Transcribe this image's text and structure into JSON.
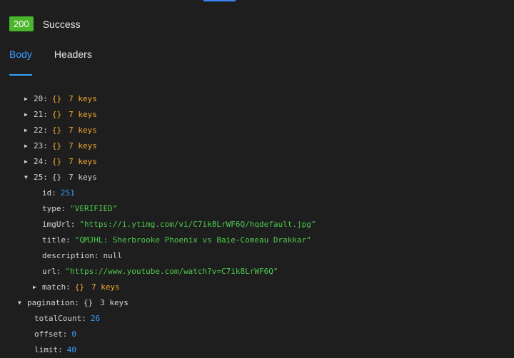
{
  "status": {
    "code": "200",
    "text": "Success"
  },
  "tabs": {
    "body": "Body",
    "headers": "Headers"
  },
  "tree": {
    "items": [
      {
        "key": "20:",
        "brace": "{}",
        "count": "7 keys"
      },
      {
        "key": "21:",
        "brace": "{}",
        "count": "7 keys"
      },
      {
        "key": "22:",
        "brace": "{}",
        "count": "7 keys"
      },
      {
        "key": "23:",
        "brace": "{}",
        "count": "7 keys"
      },
      {
        "key": "24:",
        "brace": "{}",
        "count": "7 keys"
      },
      {
        "key": "25:",
        "brace": "{}",
        "count": "7 keys"
      }
    ],
    "item25": {
      "id": {
        "key": "id:",
        "value": "251"
      },
      "type": {
        "key": "type:",
        "value": "\"VERIFIED\""
      },
      "imgUrl": {
        "key": "imgUrl:",
        "value": "\"https://i.ytimg.com/vi/C7ik8LrWF6Q/hqdefault.jpg\""
      },
      "title": {
        "key": "title:",
        "value": "\"QMJHL: Sherbrooke Phoenix vs Baie-Comeau Drakkar\""
      },
      "description": {
        "key": "description:",
        "value": "null"
      },
      "url": {
        "key": "url:",
        "value": "\"https://www.youtube.com/watch?v=C7ik8LrWF6Q\""
      },
      "match": {
        "key": "match:",
        "brace": "{}",
        "count": "7 keys"
      }
    },
    "pagination": {
      "key": "pagination:",
      "brace": "{}",
      "count": "3 keys",
      "totalCount": {
        "key": "totalCount:",
        "value": "26"
      },
      "offset": {
        "key": "offset:",
        "value": "0"
      },
      "limit": {
        "key": "limit:",
        "value": "40"
      }
    }
  }
}
